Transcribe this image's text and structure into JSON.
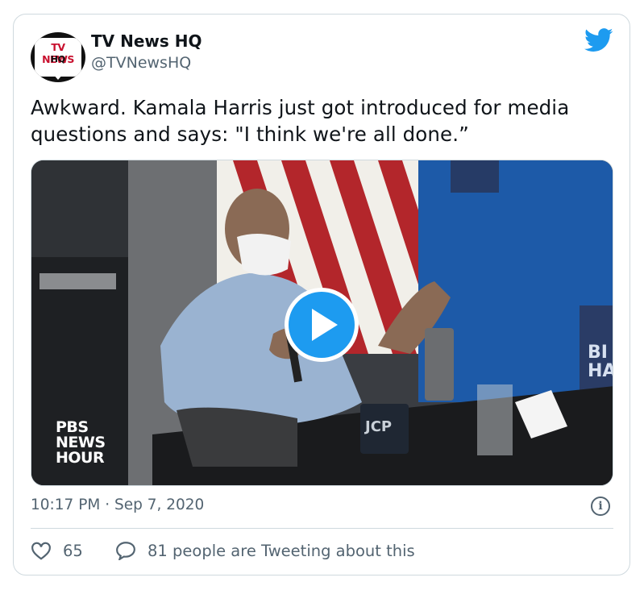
{
  "tweet": {
    "avatar": {
      "top_text": "TV NEWS",
      "bottom_text": "HQ"
    },
    "display_name": "TV News HQ",
    "handle": "@TVNewsHQ",
    "text": "Awkward. Kamala Harris just got introduced for media questions and says: \"I think we're all done.”",
    "media": {
      "type": "video",
      "watermark": [
        "PBS",
        "NEWS",
        "HOUR"
      ],
      "play_icon": "play-icon"
    },
    "timestamp": "10:17 PM · Sep 7, 2020",
    "likes": "65",
    "replies_text": "81 people are Tweeting about this"
  },
  "colors": {
    "accent": "#1d9bf0",
    "text": "#0f1419",
    "muted": "#536471",
    "border": "#cfd9de"
  }
}
